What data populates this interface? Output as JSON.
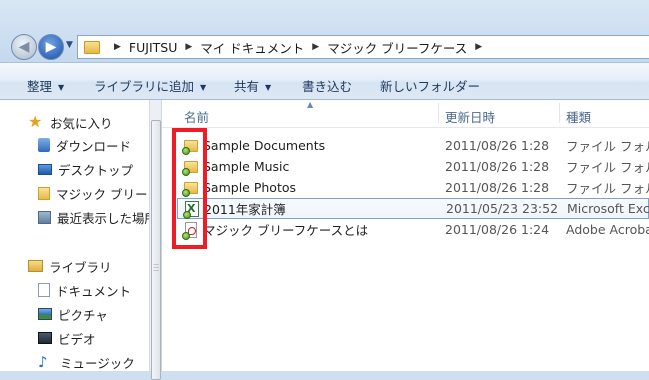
{
  "address": {
    "crumbs": [
      "FUJITSU",
      "マイ ドキュメント",
      "マジック ブリーフケース"
    ]
  },
  "toolbar": {
    "organize": "整理",
    "add_library": "ライブラリに追加",
    "share": "共有",
    "burn": "書き込む",
    "new_folder": "新しいフォルダー"
  },
  "nav": {
    "favorites": "お気に入り",
    "downloads": "ダウンロード",
    "desktop": "デスクトップ",
    "briefcase": "マジック ブリー",
    "recent": "最近表示した場所",
    "libraries": "ライブラリ",
    "documents": "ドキュメント",
    "pictures": "ピクチャ",
    "videos": "ビデオ",
    "music": "ミュージック"
  },
  "columns": {
    "name": "名前",
    "date": "更新日時",
    "type": "種類"
  },
  "files": [
    {
      "name": "Sample Documents",
      "date": "2011/08/26 1:28",
      "type": "ファイル フォル",
      "icon": "sync-folder-icon"
    },
    {
      "name": "Sample Music",
      "date": "2011/08/26 1:28",
      "type": "ファイル フォル",
      "icon": "sync-folder-icon"
    },
    {
      "name": "Sample Photos",
      "date": "2011/08/26 1:28",
      "type": "ファイル フォル",
      "icon": "sync-folder-icon"
    },
    {
      "name": "2011年家計簿",
      "date": "2011/05/23 23:52",
      "type": "Microsoft Exce",
      "icon": "excel-file-icon"
    },
    {
      "name": "マジック ブリーフケースとは",
      "date": "2011/08/26 1:24",
      "type": "Adobe Acrobat",
      "icon": "pdf-file-icon"
    }
  ],
  "colors": {
    "highlight": "#ee1c25",
    "selection_border": "#7da2ce",
    "command_text": "#1e395b"
  }
}
